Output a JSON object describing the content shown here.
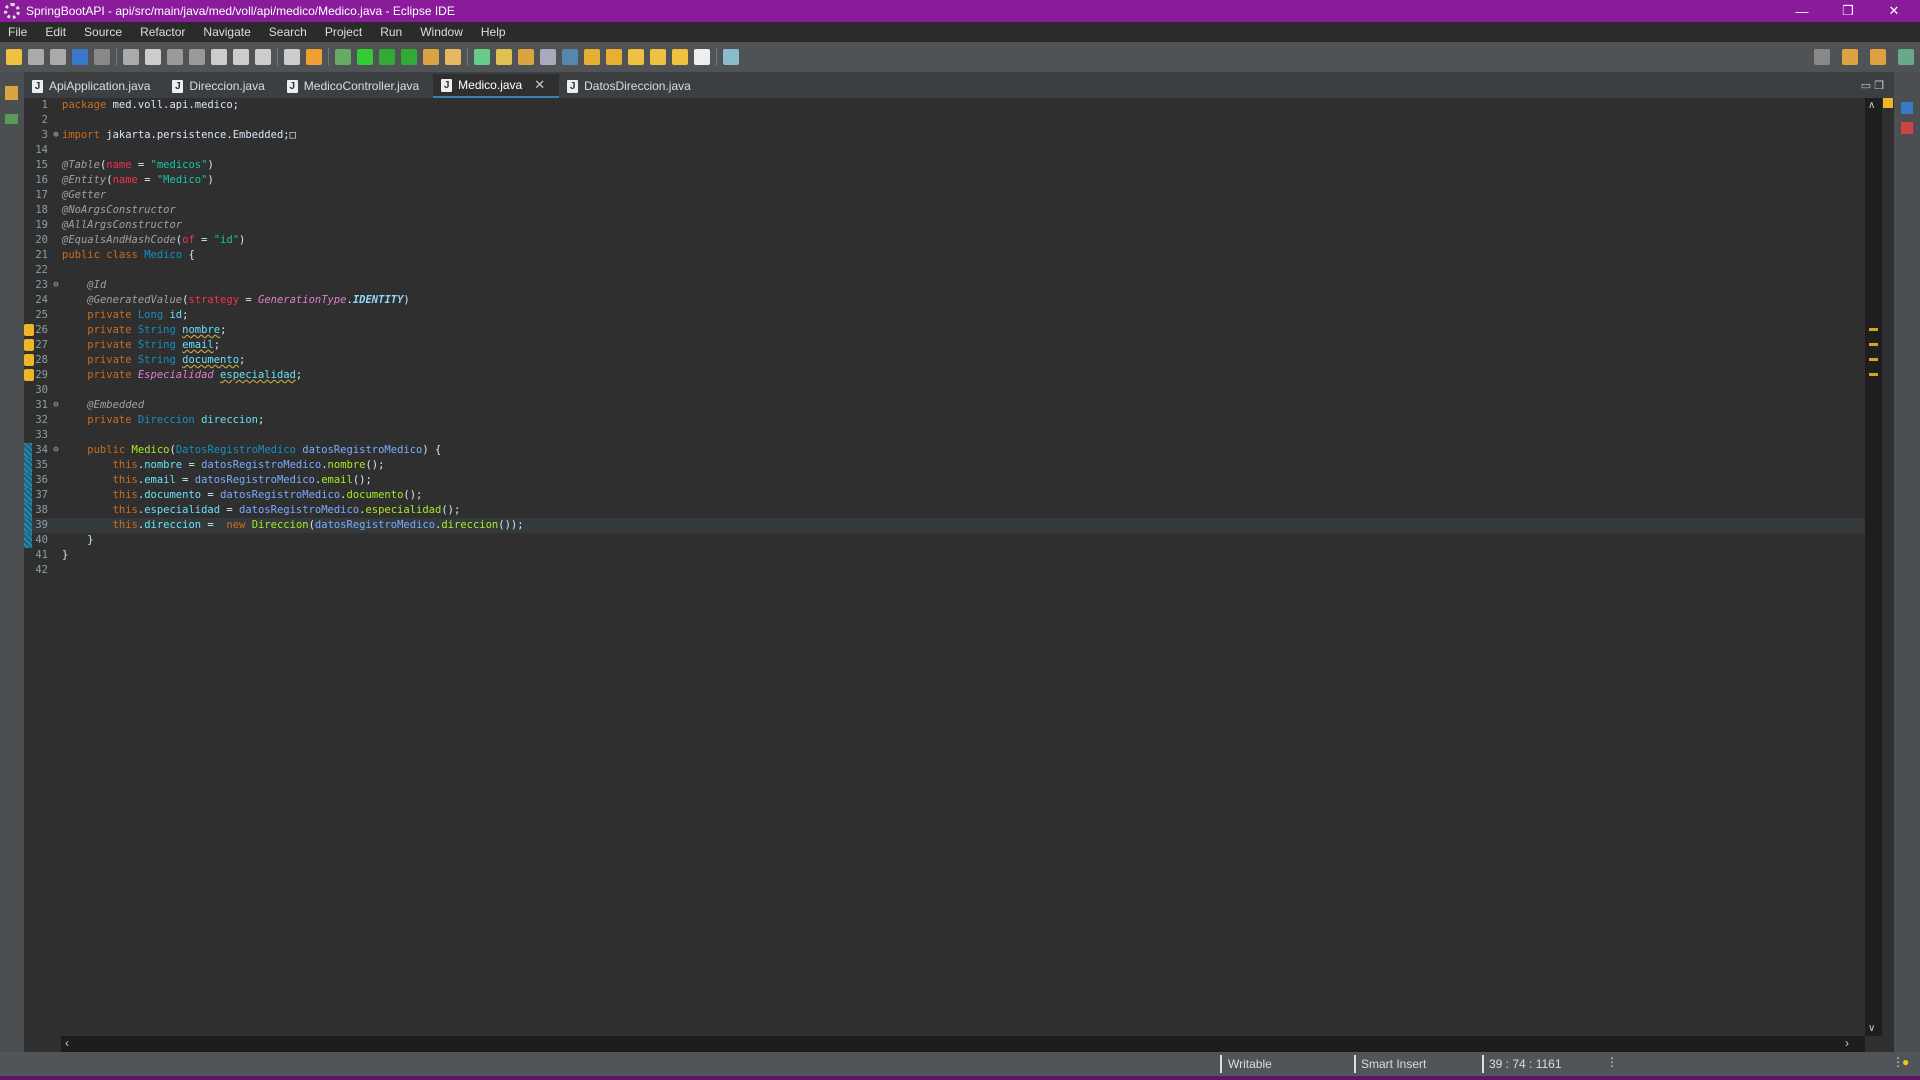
{
  "window": {
    "title": "SpringBootAPI - api/src/main/java/med/voll/api/medico/Medico.java - Eclipse IDE",
    "controls": [
      "—",
      "❐",
      "✕"
    ]
  },
  "menu": [
    "File",
    "Edit",
    "Source",
    "Refactor",
    "Navigate",
    "Search",
    "Project",
    "Run",
    "Window",
    "Help"
  ],
  "tabs": [
    {
      "label": "ApiApplication.java",
      "active": false
    },
    {
      "label": "Direccion.java",
      "active": false
    },
    {
      "label": "MedicoController.java",
      "active": false
    },
    {
      "label": "Medico.java",
      "active": true
    },
    {
      "label": "DatosDireccion.java",
      "active": false
    }
  ],
  "editor": {
    "lines": [
      {
        "n": "1",
        "t": [
          [
            "package ",
            "kw"
          ],
          [
            "med.voll.api.medico;",
            "pl"
          ]
        ]
      },
      {
        "n": "2",
        "t": []
      },
      {
        "n": "3",
        "fold": "+",
        "t": [
          [
            "import ",
            "kw"
          ],
          [
            "jakarta.persistence.Embedded;",
            "pl"
          ],
          [
            "□",
            "pl"
          ]
        ]
      },
      {
        "n": "14",
        "t": []
      },
      {
        "n": "15",
        "t": [
          [
            "@Table",
            "an"
          ],
          [
            "(",
            "pl"
          ],
          [
            "name",
            "at"
          ],
          [
            " = ",
            "pl"
          ],
          [
            "\"medicos\"",
            "st"
          ],
          [
            ")",
            "pl"
          ]
        ]
      },
      {
        "n": "16",
        "t": [
          [
            "@Entity",
            "an"
          ],
          [
            "(",
            "pl"
          ],
          [
            "name",
            "at"
          ],
          [
            " = ",
            "pl"
          ],
          [
            "\"Medico\"",
            "st"
          ],
          [
            ")",
            "pl"
          ]
        ]
      },
      {
        "n": "17",
        "t": [
          [
            "@Getter",
            "an"
          ]
        ]
      },
      {
        "n": "18",
        "t": [
          [
            "@NoArgsConstructor",
            "an"
          ]
        ]
      },
      {
        "n": "19",
        "t": [
          [
            "@AllArgsConstructor",
            "an"
          ]
        ]
      },
      {
        "n": "20",
        "t": [
          [
            "@EqualsAndHashCode",
            "an"
          ],
          [
            "(",
            "pl"
          ],
          [
            "of",
            "at"
          ],
          [
            " = ",
            "pl"
          ],
          [
            "\"id\"",
            "st"
          ],
          [
            ")",
            "pl"
          ]
        ]
      },
      {
        "n": "21",
        "t": [
          [
            "public class ",
            "kw"
          ],
          [
            "Medico",
            "ty"
          ],
          [
            " {",
            "pl"
          ]
        ]
      },
      {
        "n": "22",
        "t": []
      },
      {
        "n": "23",
        "fold": "−",
        "t": [
          [
            "    ",
            "pl"
          ],
          [
            "@Id",
            "an"
          ]
        ]
      },
      {
        "n": "24",
        "t": [
          [
            "    ",
            "pl"
          ],
          [
            "@GeneratedValue",
            "an"
          ],
          [
            "(",
            "pl"
          ],
          [
            "strategy",
            "at"
          ],
          [
            " = ",
            "pl"
          ],
          [
            "GenerationType",
            "en"
          ],
          [
            ".",
            "pl"
          ],
          [
            "IDENTITY",
            "cn"
          ],
          [
            ")",
            "pl"
          ]
        ]
      },
      {
        "n": "25",
        "t": [
          [
            "    private ",
            "kw"
          ],
          [
            "Long ",
            "ty"
          ],
          [
            "id",
            "fd"
          ],
          [
            ";",
            "pl"
          ]
        ]
      },
      {
        "n": "26",
        "warn": true,
        "t": [
          [
            "    private ",
            "kw"
          ],
          [
            "String ",
            "ty"
          ],
          [
            "nombre",
            "fd sq"
          ],
          [
            ";",
            "pl"
          ]
        ]
      },
      {
        "n": "27",
        "warn": true,
        "t": [
          [
            "    private ",
            "kw"
          ],
          [
            "String ",
            "ty"
          ],
          [
            "email",
            "fd sq"
          ],
          [
            ";",
            "pl"
          ]
        ]
      },
      {
        "n": "28",
        "warn": true,
        "t": [
          [
            "    private ",
            "kw"
          ],
          [
            "String ",
            "ty"
          ],
          [
            "documento",
            "fd sq"
          ],
          [
            ";",
            "pl"
          ]
        ]
      },
      {
        "n": "29",
        "warn": true,
        "t": [
          [
            "    private ",
            "kw"
          ],
          [
            "Especialidad ",
            "en"
          ],
          [
            "especialidad",
            "fd sq"
          ],
          [
            ";",
            "pl"
          ]
        ]
      },
      {
        "n": "30",
        "t": []
      },
      {
        "n": "31",
        "fold": "−",
        "t": [
          [
            "    ",
            "pl"
          ],
          [
            "@Embedded",
            "an"
          ]
        ]
      },
      {
        "n": "32",
        "t": [
          [
            "    private ",
            "kw"
          ],
          [
            "Direccion ",
            "ty"
          ],
          [
            "direccion",
            "fd"
          ],
          [
            ";",
            "pl"
          ]
        ]
      },
      {
        "n": "33",
        "t": []
      },
      {
        "n": "34",
        "fold": "−",
        "bar": true,
        "t": [
          [
            "    public ",
            "kw"
          ],
          [
            "Medico",
            "me"
          ],
          [
            "(",
            "pl"
          ],
          [
            "DatosRegistroMedico ",
            "ty"
          ],
          [
            "datosRegistroMedico",
            "lv"
          ],
          [
            ") {",
            "pl"
          ]
        ]
      },
      {
        "n": "35",
        "bar": true,
        "t": [
          [
            "        this",
            "kw"
          ],
          [
            ".",
            "pl"
          ],
          [
            "nombre",
            "fd"
          ],
          [
            " = ",
            "pl"
          ],
          [
            "datosRegistroMedico",
            "lv"
          ],
          [
            ".",
            "pl"
          ],
          [
            "nombre",
            "me"
          ],
          [
            "();",
            "pl"
          ]
        ]
      },
      {
        "n": "36",
        "bar": true,
        "t": [
          [
            "        this",
            "kw"
          ],
          [
            ".",
            "pl"
          ],
          [
            "email",
            "fd"
          ],
          [
            " = ",
            "pl"
          ],
          [
            "datosRegistroMedico",
            "lv"
          ],
          [
            ".",
            "pl"
          ],
          [
            "email",
            "me"
          ],
          [
            "();",
            "pl"
          ]
        ]
      },
      {
        "n": "37",
        "bar": true,
        "t": [
          [
            "        this",
            "kw"
          ],
          [
            ".",
            "pl"
          ],
          [
            "documento",
            "fd"
          ],
          [
            " = ",
            "pl"
          ],
          [
            "datosRegistroMedico",
            "lv"
          ],
          [
            ".",
            "pl"
          ],
          [
            "documento",
            "me"
          ],
          [
            "();",
            "pl"
          ]
        ]
      },
      {
        "n": "38",
        "bar": true,
        "t": [
          [
            "        this",
            "kw"
          ],
          [
            ".",
            "pl"
          ],
          [
            "especialidad",
            "fd"
          ],
          [
            " = ",
            "pl"
          ],
          [
            "datosRegistroMedico",
            "lv"
          ],
          [
            ".",
            "pl"
          ],
          [
            "especialidad",
            "me"
          ],
          [
            "();",
            "pl"
          ]
        ]
      },
      {
        "n": "39",
        "bar": true,
        "cur": true,
        "t": [
          [
            "        this",
            "kw"
          ],
          [
            ".",
            "pl"
          ],
          [
            "direccion",
            "fd"
          ],
          [
            " =  ",
            "pl"
          ],
          [
            "new ",
            "kw"
          ],
          [
            "Direccion",
            "me"
          ],
          [
            "(",
            "pl"
          ],
          [
            "datosRegistroMedico",
            "lv"
          ],
          [
            ".",
            "pl"
          ],
          [
            "direccion",
            "me"
          ],
          [
            "());",
            "pl"
          ]
        ]
      },
      {
        "n": "40",
        "bar": true,
        "t": [
          [
            "    }",
            "pl"
          ]
        ]
      },
      {
        "n": "41",
        "t": [
          [
            "}",
            "pl"
          ]
        ]
      },
      {
        "n": "42",
        "t": []
      }
    ]
  },
  "status": {
    "mode": "Writable",
    "insert": "Smart Insert",
    "position": "39 : 74 : 1161"
  },
  "colors": {
    "titlebar": "#8a1c9c",
    "keyword": "#cc6c1d",
    "type": "#1290c3",
    "string": "#17c6a3",
    "field": "#66e1f8"
  }
}
